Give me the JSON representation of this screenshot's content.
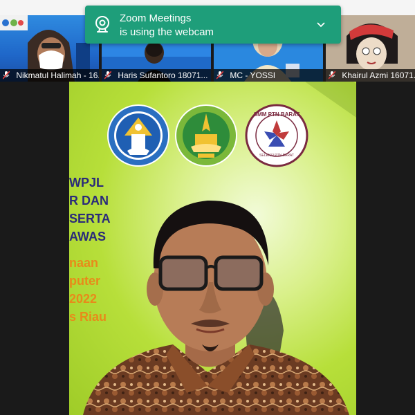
{
  "toast": {
    "title": "Zoom Meetings",
    "message": "is using the webcam",
    "icon": "webcam-icon",
    "expand_icon": "chevron-down-icon",
    "color": "#1e9e7a"
  },
  "participants": [
    {
      "name": "Nikmatul Halimah - 16...",
      "muted": true
    },
    {
      "name": "Haris Sufantoro 18071...",
      "muted": true
    },
    {
      "name": "MC - YOSSI",
      "muted": true
    },
    {
      "name": "Khairul Azmi 16071...",
      "muted": true
    }
  ],
  "main_video": {
    "banner_lines": [
      {
        "text": "WPJL",
        "color": "dark"
      },
      {
        "text": "R DAN",
        "color": "dark"
      },
      {
        "text": "SERTA",
        "color": "dark"
      },
      {
        "text": "AWAS",
        "color": "dark"
      },
      {
        "text": "naan",
        "color": "orange"
      },
      {
        "text": "puter",
        "color": "orange"
      },
      {
        "text": "2022",
        "color": "orange"
      },
      {
        "text": "s Riau",
        "color": "orange"
      }
    ],
    "logos": [
      "tut-wuri-handayani-logo",
      "universitas-riau-logo",
      "smm-ptn-barat-logo"
    ],
    "logo3_ring_text": "SMM PTN BARAT",
    "logo3_inner_text": "SELEKSI PTN BARAT"
  }
}
